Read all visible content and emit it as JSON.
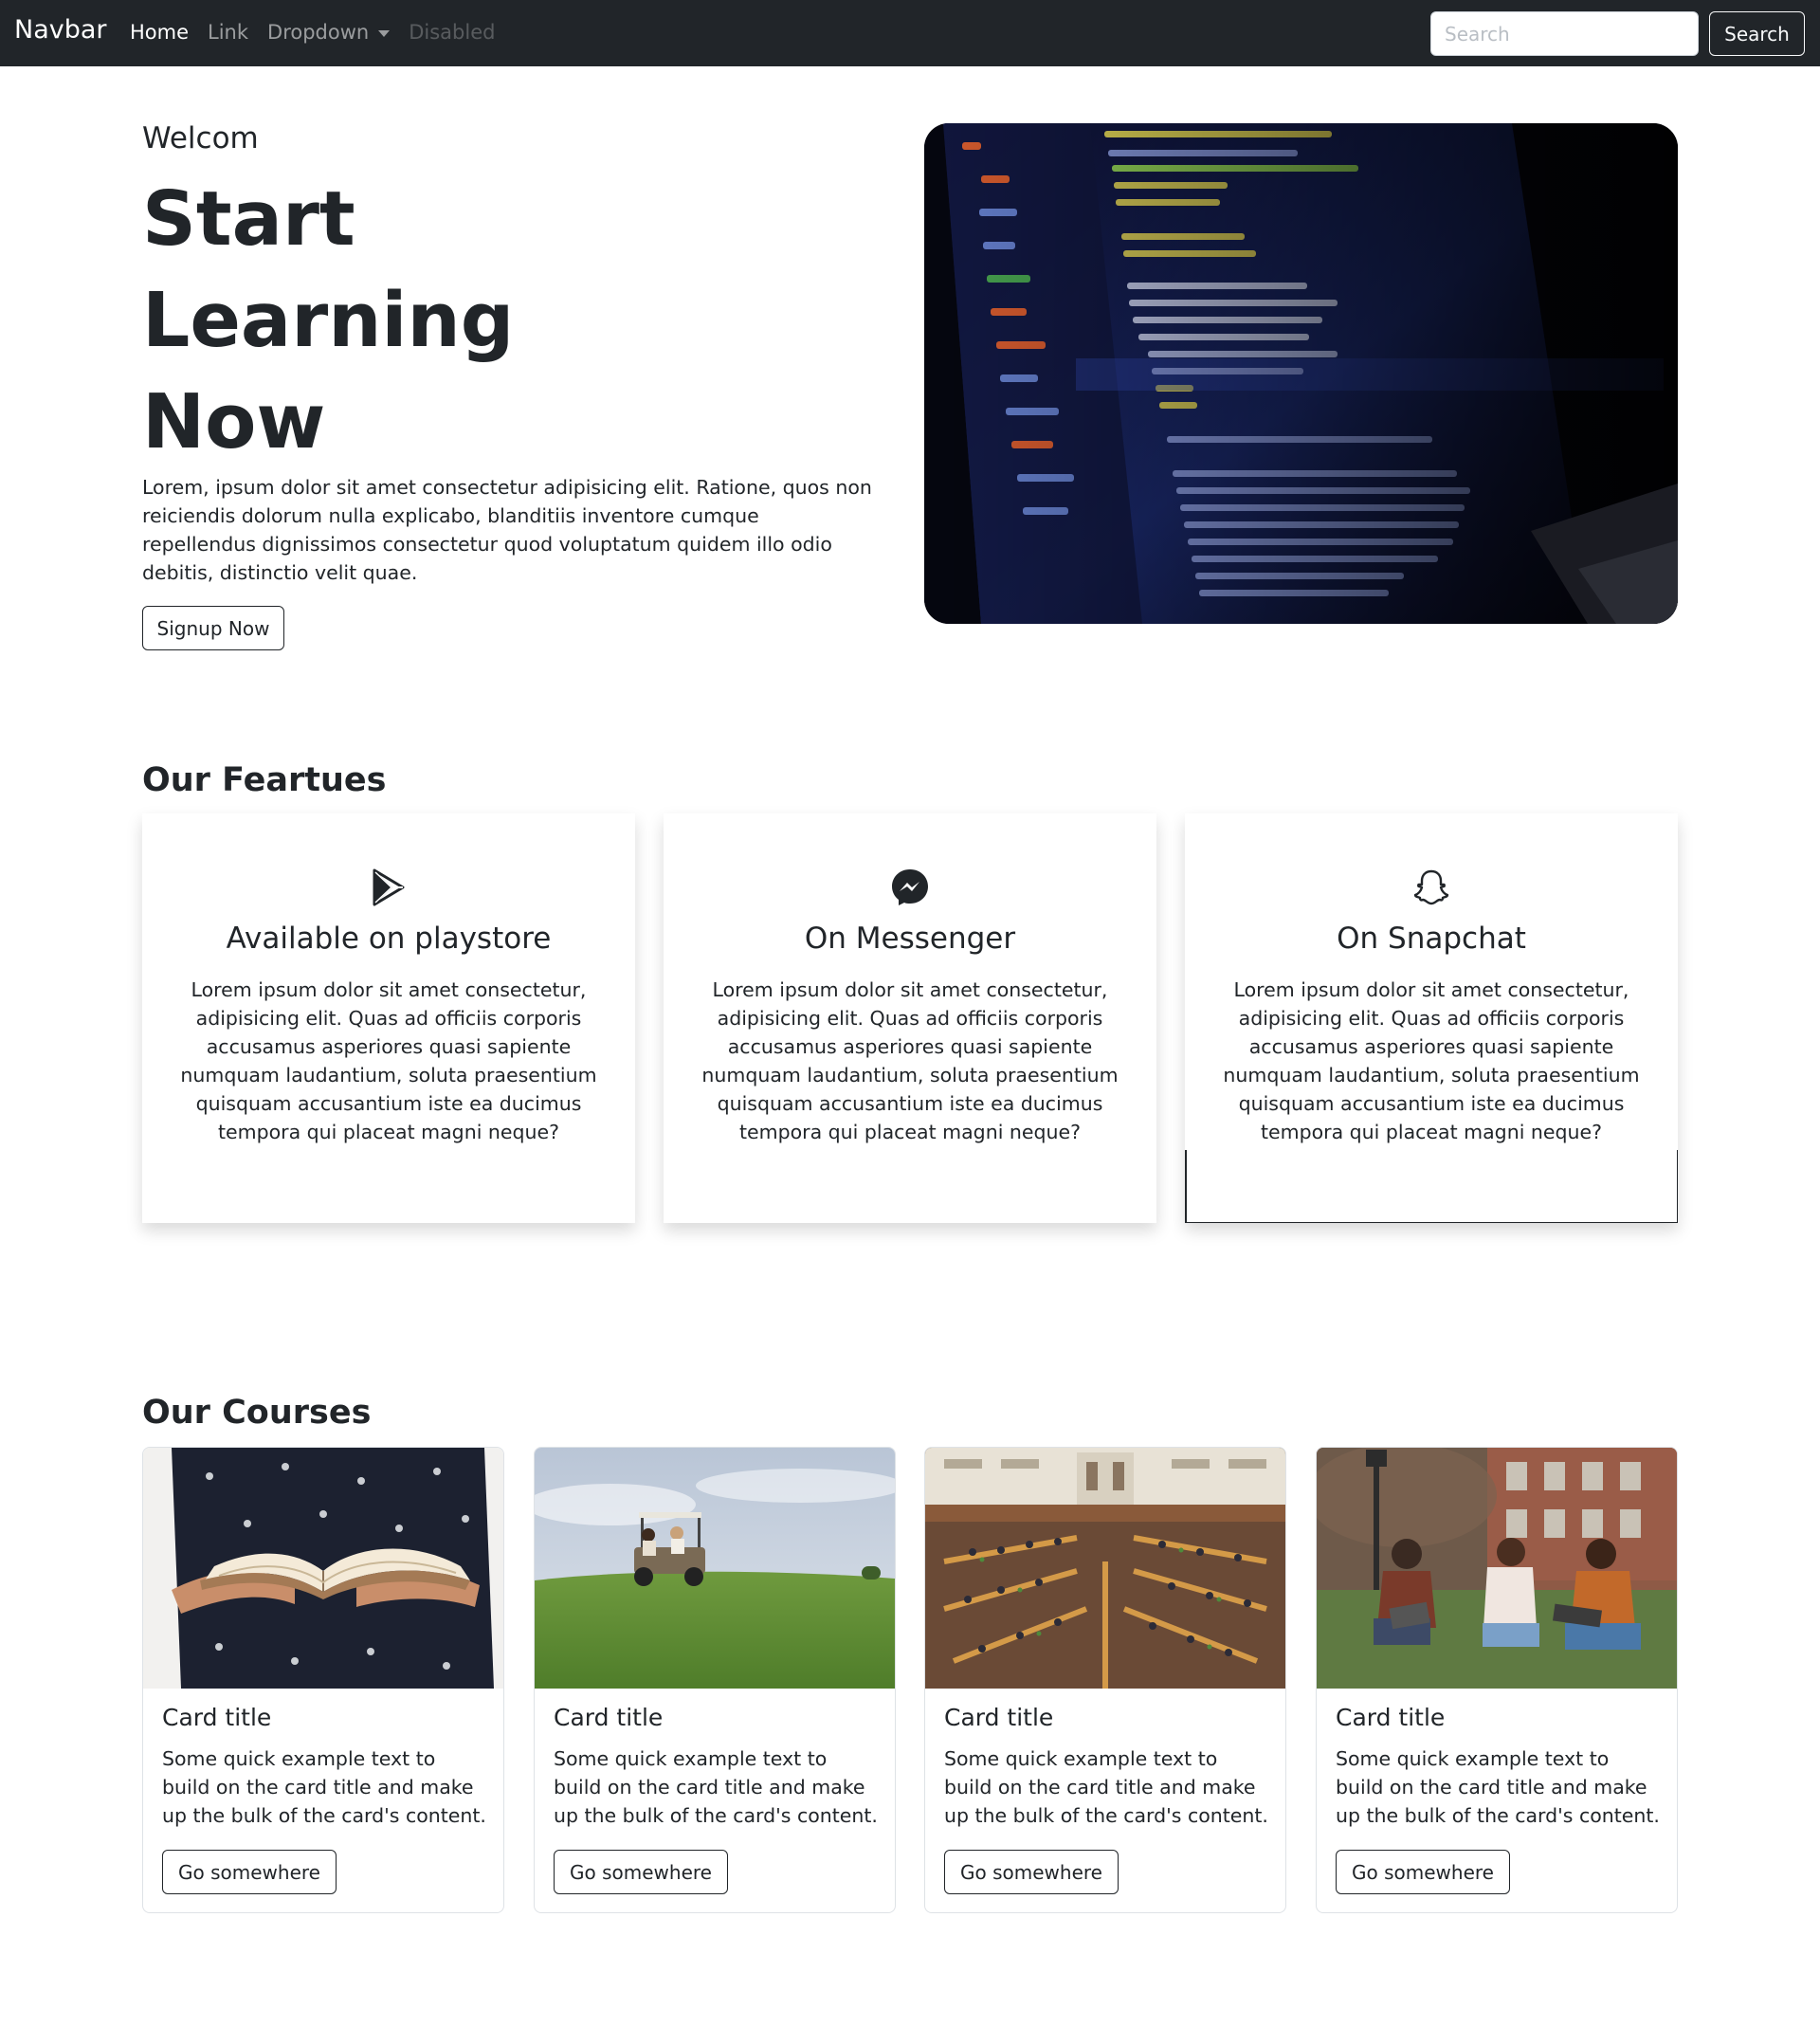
{
  "navbar": {
    "brand": "Navbar",
    "links": [
      {
        "label": "Home",
        "state": "active"
      },
      {
        "label": "Link",
        "state": "normal"
      },
      {
        "label": "Dropdown",
        "state": "dropdown"
      },
      {
        "label": "Disabled",
        "state": "disabled"
      }
    ],
    "search_placeholder": "Search",
    "search_button": "Search"
  },
  "hero": {
    "kicker": "Welcom",
    "title_lines": [
      "Start",
      "Learning",
      "Now"
    ],
    "text": "Lorem, ipsum dolor sit amet consectetur adipisicing elit. Ratione, quos non reiciendis dolorum nulla explicabo, blanditiis inventore cumque repellendus dignissimos consectetur quod voluptatum quidem illo odio debitis, distinctio velit quae.",
    "button": "Signup Now",
    "image_icon": "laptop-code-photo"
  },
  "features": {
    "title": "Our Feartues",
    "cards": [
      {
        "icon": "google-play-icon",
        "heading": "Available on playstore",
        "text": "Lorem ipsum dolor sit amet consectetur, adipisicing elit. Quas ad officiis corporis accusamus asperiores quasi sapiente numquam laudantium, soluta praesentium quisquam accusantium iste ea ducimus tempora qui placeat magni neque?"
      },
      {
        "icon": "messenger-icon",
        "heading": "On Messenger",
        "text": "Lorem ipsum dolor sit amet consectetur, adipisicing elit. Quas ad officiis corporis accusamus asperiores quasi sapiente numquam laudantium, soluta praesentium quisquam accusantium iste ea ducimus tempora qui placeat magni neque?"
      },
      {
        "icon": "snapchat-icon",
        "heading": "On Snapchat",
        "text": "Lorem ipsum dolor sit amet consectetur, adipisicing elit. Quas ad officiis corporis accusamus asperiores quasi sapiente numquam laudantium, soluta praesentium quisquam accusantium iste ea ducimus tempora qui placeat magni neque?"
      }
    ]
  },
  "courses": {
    "title": "Our Courses",
    "cards": [
      {
        "image": "book-in-hands-photo",
        "title": "Card title",
        "text": "Some quick example text to build on the card title and make up the bulk of the card's content.",
        "button": "Go somewhere"
      },
      {
        "image": "golf-cart-on-grass-photo",
        "title": "Card title",
        "text": "Some quick example text to build on the card title and make up the bulk of the card's content.",
        "button": "Go somewhere"
      },
      {
        "image": "library-reading-room-photo",
        "title": "Card title",
        "text": "Some quick example text to build on the card title and make up the bulk of the card's content.",
        "button": "Go somewhere"
      },
      {
        "image": "students-studying-outdoors-photo",
        "title": "Card title",
        "text": "Some quick example text to build on the card title and make up the bulk of the card's content.",
        "button": "Go somewhere"
      }
    ]
  },
  "colors": {
    "navbar_bg": "#212529",
    "text": "#212529",
    "card_border": "#dee2e6"
  }
}
